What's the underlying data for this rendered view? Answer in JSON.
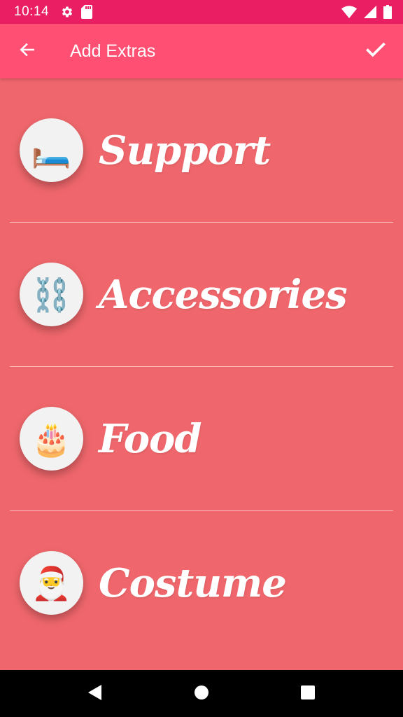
{
  "status_bar": {
    "time": "10:14",
    "icons_left": [
      "gear-icon",
      "sd-card-icon"
    ],
    "icons_right": [
      "wifi-icon",
      "signal-icon",
      "battery-icon"
    ],
    "color": "#e91e63"
  },
  "app_bar": {
    "title": "Add Extras",
    "back_icon": "arrow-back-icon",
    "confirm_icon": "check-icon",
    "color": "#ff4f73"
  },
  "content": {
    "background": "#ef676c",
    "items": [
      {
        "label": "Support",
        "emoji": "🛏️",
        "icon": "bed-icon"
      },
      {
        "label": "Accessories",
        "emoji": "⛓️",
        "icon": "chains-icon"
      },
      {
        "label": "Food",
        "emoji": "🎂",
        "icon": "cake-icon"
      },
      {
        "label": "Costume",
        "emoji": "🎅",
        "icon": "santa-icon"
      }
    ]
  },
  "nav_bar": {
    "buttons": [
      "back-triangle-icon",
      "home-circle-icon",
      "recents-square-icon"
    ]
  }
}
